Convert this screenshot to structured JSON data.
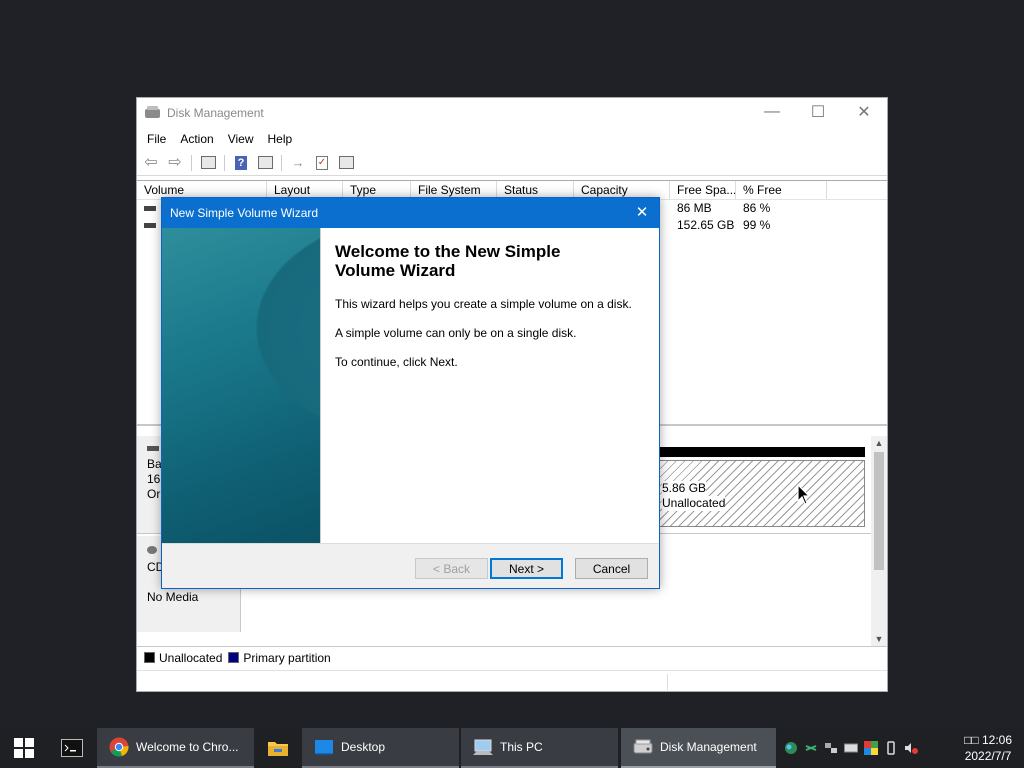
{
  "dm": {
    "title": "Disk Management",
    "menu": [
      "File",
      "Action",
      "View",
      "Help"
    ],
    "columns": [
      "Volume",
      "Layout",
      "Type",
      "File System",
      "Status",
      "Capacity",
      "Free Spa...",
      "% Free"
    ],
    "rows": [
      {
        "volume": "",
        "free": "86 MB",
        "pct": "86 %"
      },
      {
        "volume": "",
        "free": "152.65 GB",
        "pct": "99 %"
      }
    ],
    "disk0": {
      "l1": "Ba",
      "l2": "16(",
      "l3": "Or"
    },
    "partition": {
      "size": "5.86 GB",
      "status": "Unallocated"
    },
    "cd": {
      "name": "CD",
      "media": "No Media"
    },
    "legend": [
      {
        "label": "Unallocated",
        "color": "#000000"
      },
      {
        "label": "Primary partition",
        "color": "#000080"
      }
    ]
  },
  "wizard": {
    "title": "New Simple Volume Wizard",
    "heading_1": "Welcome to the New Simple",
    "heading_2": "Volume Wizard",
    "p1": "This wizard helps you create a simple volume on a disk.",
    "p2": "A simple volume can only be on a single disk.",
    "p3": "To continue, click Next.",
    "back": "< Back",
    "next": "Next >",
    "cancel": "Cancel"
  },
  "taskbar": {
    "items": [
      {
        "label": "Welcome to Chro...",
        "icon": "chrome-icon"
      },
      {
        "label": "",
        "icon": "file-explorer-icon"
      },
      {
        "label": "Desktop",
        "icon": "desktop-icon"
      },
      {
        "label": "This PC",
        "icon": "this-pc-icon"
      },
      {
        "label": "Disk Management",
        "icon": "disk-management-icon"
      }
    ],
    "time": "12:06",
    "time_prefix": "□□",
    "date": "2022/7/7"
  },
  "colors": {
    "wizard_title": "#0b6fcf",
    "taskbar": "#1e2024",
    "desktop": "#202126"
  }
}
